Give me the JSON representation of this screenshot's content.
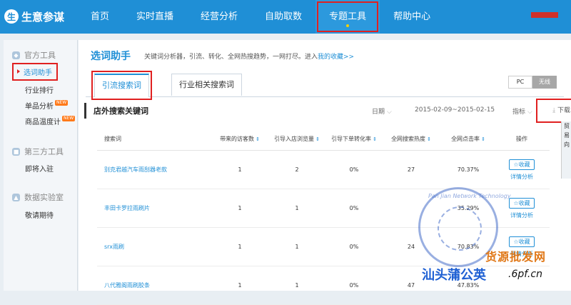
{
  "app": {
    "logo_text": "生意参谋",
    "logo_glyph": "生"
  },
  "nav": {
    "items": [
      "首页",
      "实时直播",
      "经营分析",
      "自助取数",
      "专题工具",
      "帮助中心"
    ]
  },
  "sidebar": {
    "groups": [
      {
        "label": "官方工具",
        "icon": "shield-icon"
      },
      {
        "label": "第三方工具",
        "icon": "cube-icon"
      },
      {
        "label": "数据实验室",
        "icon": "flask-icon"
      }
    ],
    "items": [
      "选词助手",
      "行业排行",
      "单品分析",
      "商品温度计",
      "即将入驻",
      "敬请期待"
    ],
    "new_badge": "NEW"
  },
  "main": {
    "title": "选词助手",
    "desc": "关键词分析器，引流、转化、全网热搜趋势，一网打尽。进入",
    "desc_link": "我的收藏>>",
    "tabs": [
      "引流搜索词",
      "行业相关搜索词"
    ],
    "device": [
      "PC",
      "无线"
    ],
    "section_title": "店外搜索关键词",
    "date_label": "日期",
    "date_range": "2015-02-09~2015-02-15",
    "metric_label": "指标",
    "download": "下载"
  },
  "table": {
    "headers": [
      "搜索词",
      "带来的访客数",
      "引导入店浏览量",
      "引导下单转化率",
      "全网搜索热度",
      "全网点击率",
      "操作"
    ],
    "rows": [
      {
        "keyword": "别克君越汽车雨刮器老款",
        "visitors": "1",
        "pv": "2",
        "conv": "0%",
        "heat": "27",
        "ctr": "70.37%"
      },
      {
        "keyword": "丰田卡罗拉雨刷片",
        "visitors": "1",
        "pv": "1",
        "conv": "0%",
        "heat": "",
        "ctr": "35.29%"
      },
      {
        "keyword": "srx雨刷",
        "visitors": "1",
        "pv": "1",
        "conv": "0%",
        "heat": "24",
        "ctr": "70.83%"
      },
      {
        "keyword": "八代雅阁雨刷胶条",
        "visitors": "1",
        "pv": "1",
        "conv": "0%",
        "heat": "47",
        "ctr": "47.83%"
      }
    ],
    "fav_label": "收藏",
    "detail_label": "详情分析"
  },
  "watermark": {
    "ring_text": "Pan Jian Network Technology",
    "company": "汕头蒲公英",
    "site": "货源批发网",
    "url": ".6pf.cn"
  },
  "right_fragment": "贸易向"
}
